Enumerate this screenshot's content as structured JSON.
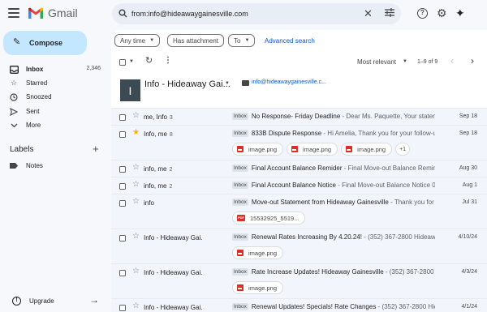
{
  "header": {
    "app_name": "Gmail",
    "search_value": "from:info@hideawaygainesville.com"
  },
  "sidebar": {
    "compose_label": "Compose",
    "items": [
      {
        "label": "Inbox",
        "count": "2,346",
        "icon": "inbox-icon"
      },
      {
        "label": "Starred",
        "count": "",
        "icon": "star-icon"
      },
      {
        "label": "Snoozed",
        "count": "",
        "icon": "clock-icon"
      },
      {
        "label": "Sent",
        "count": "",
        "icon": "send-icon"
      },
      {
        "label": "More",
        "count": "",
        "icon": "chevron-down-icon"
      }
    ],
    "labels_title": "Labels",
    "labels": [
      {
        "label": "Notes",
        "icon": "label-icon"
      }
    ],
    "upgrade_label": "Upgrade"
  },
  "filters": {
    "any_time": "Any time",
    "has_attachment": "Has attachment",
    "to": "To",
    "advanced_search": "Advanced search"
  },
  "toolbar": {
    "sort_label": "Most relevant",
    "range": "1–9 of 9"
  },
  "contact": {
    "avatar_letter": "I",
    "name": "Info - Hideaway Gai...",
    "email": "info@hideawaygainesville.c..."
  },
  "emails": [
    {
      "sender": "me, Info",
      "count": "3",
      "starred": false,
      "badge": "Inbox",
      "subject": "No Response- Friday Deadline",
      "snippet": " - Dear Ms. Paquette, Your statem...",
      "date": "Sep 18",
      "attachments": []
    },
    {
      "sender": "Info, me",
      "count": "8",
      "starred": true,
      "badge": "Inbox",
      "subject": "833B Dispute Response",
      "snippet": " - Hi Amelia, Thank you for your follow-u...",
      "date": "Sep 18",
      "attachments": [
        "image.png",
        "image.png",
        "image.png"
      ],
      "more": "+1"
    },
    {
      "sender": "info, me",
      "count": "2",
      "starred": false,
      "badge": "Inbox",
      "subject": "Final Account Balance Remider",
      "snippet": " - Final Move-out Balance Remin...",
      "date": "Aug 30",
      "attachments": []
    },
    {
      "sender": "info, me",
      "count": "2",
      "starred": false,
      "badge": "Inbox",
      "subject": "Final Account Balance Notice",
      "snippet": " - Final Move-out Balance Notice 0...",
      "date": "Aug 1",
      "attachments": []
    },
    {
      "sender": "info",
      "count": "",
      "starred": false,
      "badge": "Inbox",
      "subject": "Move-out Statement from Hideaway Gainesville",
      "snippet": " - Thank you for ...",
      "date": "Jul 31",
      "attachments": [
        "15532925_5519..."
      ],
      "attachment_type": "pdf"
    },
    {
      "sender": "Info - Hideaway Gai.",
      "count": "",
      "starred": false,
      "badge": "Inbox",
      "subject": "Renewal Rates Increasing By 4.20.24!",
      "snippet": " - (352) 367-2800 Hideawa...",
      "date": "4/10/24",
      "attachments": [
        "image.png"
      ]
    },
    {
      "sender": "Info - Hideaway Gai.",
      "count": "",
      "starred": false,
      "badge": "Inbox",
      "subject": "Rate Increase Updates! Hideaway Gainesville",
      "snippet": " - (352) 367-2800 Hideaw...",
      "date": "4/3/24",
      "attachments": [
        "image.png"
      ]
    },
    {
      "sender": "Info - Hideaway Gai.",
      "count": "",
      "starred": false,
      "badge": "Inbox",
      "subject": "Renewal Updates! Specials! Rate Changes",
      "snippet": " - (352) 367-2800 Hideaw...",
      "date": "4/1/24",
      "attachments": []
    }
  ]
}
